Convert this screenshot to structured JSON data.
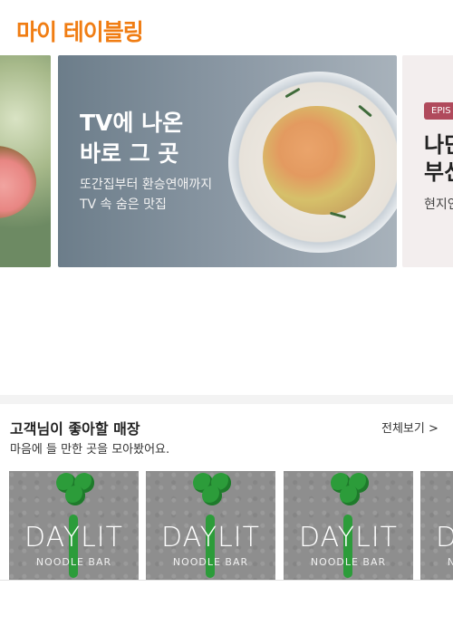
{
  "header": {
    "logo_text": "마이 테이블링"
  },
  "carousel": {
    "main_slide": {
      "headline": "TV에 나온\n바로 그 곳",
      "subline": "또간집부터 환승연애까지\nTV 속 숨은 맛집"
    },
    "right_slide": {
      "badge": "EPIS",
      "title": "나단\n부선",
      "subtitle": "현지인"
    }
  },
  "section": {
    "title": "고객님이 좋아할 매장",
    "see_all": "전체보기 >",
    "subtitle": "마음에 들 만한 곳을 모아봤어요."
  },
  "cards": [
    {
      "brand": "DAYLIT",
      "sub": "NOODLE BAR"
    },
    {
      "brand": "DAYLIT",
      "sub": "NOODLE BAR"
    },
    {
      "brand": "DAYLIT",
      "sub": "NOODLE BAR"
    },
    {
      "brand": "DAYLIT",
      "sub": "NOODLE BAR"
    }
  ],
  "colors": {
    "brand_orange": "#f07d13",
    "badge": "#b04a5c"
  }
}
